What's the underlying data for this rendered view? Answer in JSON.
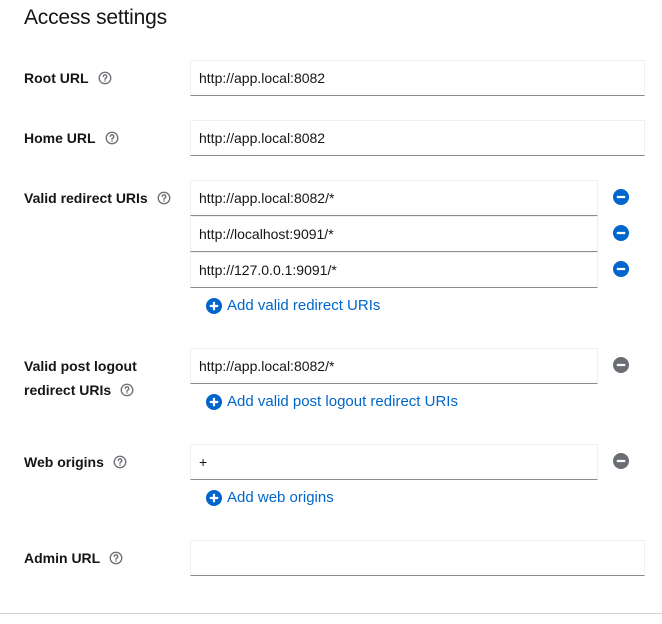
{
  "section": {
    "title": "Access settings"
  },
  "colors": {
    "accent": "#0066cc",
    "remove_active": "#0066cc",
    "remove_disabled": "#6a6e73",
    "help": "#6a6e73"
  },
  "root_url": {
    "label": "Root URL",
    "value": "http://app.local:8082"
  },
  "home_url": {
    "label": "Home URL",
    "value": "http://app.local:8082"
  },
  "redirect_uris": {
    "label": "Valid redirect URIs",
    "values": [
      "http://app.local:8082/*",
      "http://localhost:9091/*",
      "http://127.0.0.1:9091/*"
    ],
    "add_label": "Add valid redirect URIs"
  },
  "post_logout": {
    "label_line1": "Valid post logout",
    "label_line2": "redirect URIs",
    "values": [
      "http://app.local:8082/*"
    ],
    "add_label": "Add valid post logout redirect URIs"
  },
  "web_origins": {
    "label": "Web origins",
    "values": [
      "+"
    ],
    "add_label": "Add web origins"
  },
  "admin_url": {
    "label": "Admin URL",
    "value": ""
  },
  "icons": {
    "help": "help-circle-icon",
    "remove": "minus-circle-icon",
    "add": "plus-circle-icon"
  }
}
